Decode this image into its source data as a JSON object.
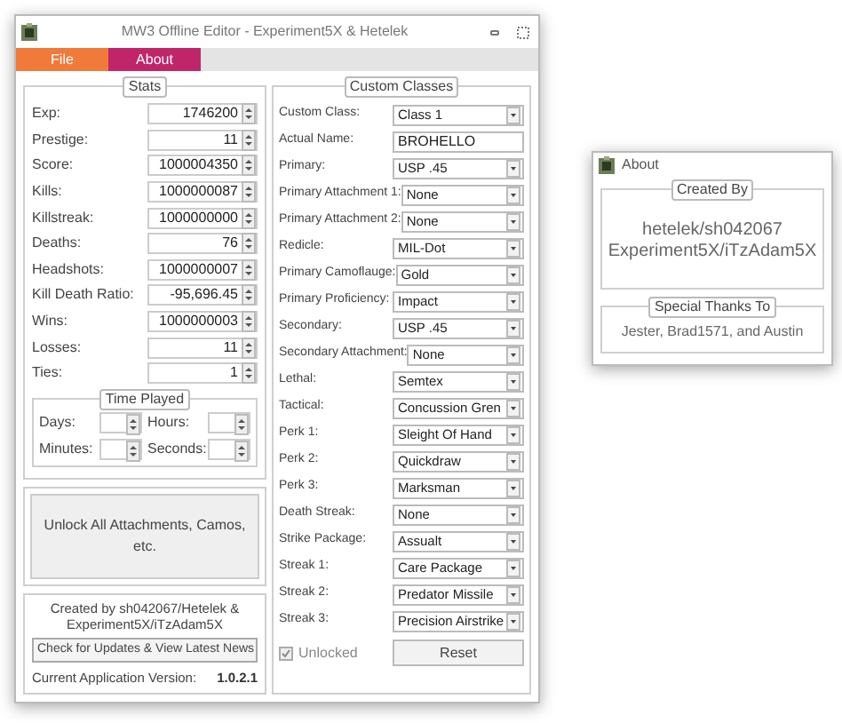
{
  "main_window": {
    "title": "MW3 Offline Editor - Experiment5X & Hetelek"
  },
  "menu": [
    {
      "label": "File",
      "color": "#f07a3a"
    },
    {
      "label": "About",
      "color": "#c0256a"
    }
  ],
  "stats": {
    "title": "Stats",
    "rows": [
      {
        "label": "Exp:",
        "value": "1746200"
      },
      {
        "label": "Prestige:",
        "value": "11"
      },
      {
        "label": "Score:",
        "value": "1000004350"
      },
      {
        "label": "Kills:",
        "value": "1000000087"
      },
      {
        "label": "Killstreak:",
        "value": "1000000000"
      },
      {
        "label": "Deaths:",
        "value": "76"
      },
      {
        "label": "Headshots:",
        "value": "1000000007"
      },
      {
        "label": "Kill Death Ratio:",
        "value": "-95,696.45"
      },
      {
        "label": "Wins:",
        "value": "1000000003"
      },
      {
        "label": "Losses:",
        "value": "11"
      },
      {
        "label": "Ties:",
        "value": "1"
      }
    ]
  },
  "time_played": {
    "title": "Time Played",
    "fields": [
      {
        "label": "Days:"
      },
      {
        "label": "Hours:"
      },
      {
        "label": "Minutes:"
      },
      {
        "label": "Seconds:"
      }
    ]
  },
  "unlock_button": "Unlock All Attachments, Camos, etc.",
  "credits": {
    "text": "Created by sh042067/Hetelek & Experiment5X/iTzAdam5X",
    "update_button": "Check for Updates & View Latest News",
    "version_label": "Current Application Version:",
    "version": "1.0.2.1"
  },
  "custom_classes": {
    "title": "Custom Classes",
    "rows": [
      {
        "label": "Custom Class:",
        "value": "Class 1",
        "kind": "combo"
      },
      {
        "label": "Actual Name:",
        "value": "BROHELLO",
        "kind": "text"
      },
      {
        "label": "Primary:",
        "value": "USP .45",
        "kind": "combo"
      },
      {
        "label": "Primary Attachment 1:",
        "value": "None",
        "kind": "combo"
      },
      {
        "label": "Primary Attachment 2:",
        "value": "None",
        "kind": "combo"
      },
      {
        "label": "Redicle:",
        "value": "MIL-Dot",
        "kind": "combo"
      },
      {
        "label": "Primary Camoflauge:",
        "value": "Gold",
        "kind": "combo"
      },
      {
        "label": "Primary Proficiency:",
        "value": "Impact",
        "kind": "combo"
      },
      {
        "label": "Secondary:",
        "value": "USP .45",
        "kind": "combo"
      },
      {
        "label": "Secondary Attachment:",
        "value": "None",
        "kind": "combo"
      },
      {
        "label": "Lethal:",
        "value": "Semtex",
        "kind": "combo"
      },
      {
        "label": "Tactical:",
        "value": "Concussion Gren",
        "kind": "combo"
      },
      {
        "label": "Perk 1:",
        "value": "Sleight Of Hand",
        "kind": "combo"
      },
      {
        "label": "Perk 2:",
        "value": "Quickdraw",
        "kind": "combo"
      },
      {
        "label": "Perk 3:",
        "value": "Marksman",
        "kind": "combo"
      },
      {
        "label": "Death Streak:",
        "value": "None",
        "kind": "combo"
      },
      {
        "label": "Strike Package:",
        "value": "Assualt",
        "kind": "combo"
      },
      {
        "label": "Streak 1:",
        "value": "Care Package",
        "kind": "combo"
      },
      {
        "label": "Streak 2:",
        "value": "Predator Missile",
        "kind": "combo"
      },
      {
        "label": "Streak 3:",
        "value": "Precision Airstrike",
        "kind": "combo"
      }
    ],
    "unlocked": {
      "label": "Unlocked",
      "checked": true,
      "disabled": true
    },
    "reset_button": "Reset"
  },
  "about_window": {
    "title": "About",
    "created_by": {
      "title": "Created By",
      "lines": [
        "hetelek/sh042067",
        "Experiment5X/iTzAdam5X"
      ]
    },
    "thanks": {
      "title": "Special Thanks To",
      "text": "Jester, Brad1571, and Austin"
    }
  }
}
